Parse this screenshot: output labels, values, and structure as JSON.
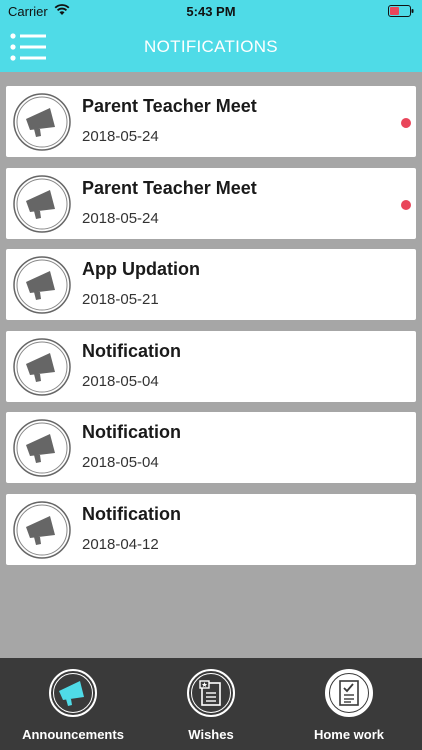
{
  "status_bar": {
    "carrier": "Carrier",
    "time": "5:43 PM"
  },
  "header": {
    "title": "NOTIFICATIONS",
    "menu_icon": "menu-list-icon"
  },
  "notifications": [
    {
      "title": "Parent Teacher Meet",
      "date": "2018-05-24",
      "unread": true,
      "icon": "megaphone-icon"
    },
    {
      "title": "Parent Teacher Meet",
      "date": "2018-05-24",
      "unread": true,
      "icon": "megaphone-icon"
    },
    {
      "title": "App Updation",
      "date": "2018-05-21",
      "unread": false,
      "icon": "megaphone-icon"
    },
    {
      "title": "Notification",
      "date": "2018-05-04",
      "unread": false,
      "icon": "megaphone-icon"
    },
    {
      "title": "Notification",
      "date": "2018-05-04",
      "unread": false,
      "icon": "megaphone-icon"
    },
    {
      "title": "Notification",
      "date": "2018-04-12",
      "unread": false,
      "icon": "megaphone-icon"
    }
  ],
  "tabs": [
    {
      "label": "Announcements",
      "icon": "megaphone-icon",
      "active": true
    },
    {
      "label": "Wishes",
      "icon": "card-icon",
      "active": false
    },
    {
      "label": "Home work",
      "icon": "document-icon",
      "active": false
    }
  ],
  "colors": {
    "accent": "#4fdbe7",
    "background": "#a6a6a6",
    "tabbar": "#3a3a3a",
    "unread_dot": "#e9455a",
    "icon_gray": "#666666"
  }
}
